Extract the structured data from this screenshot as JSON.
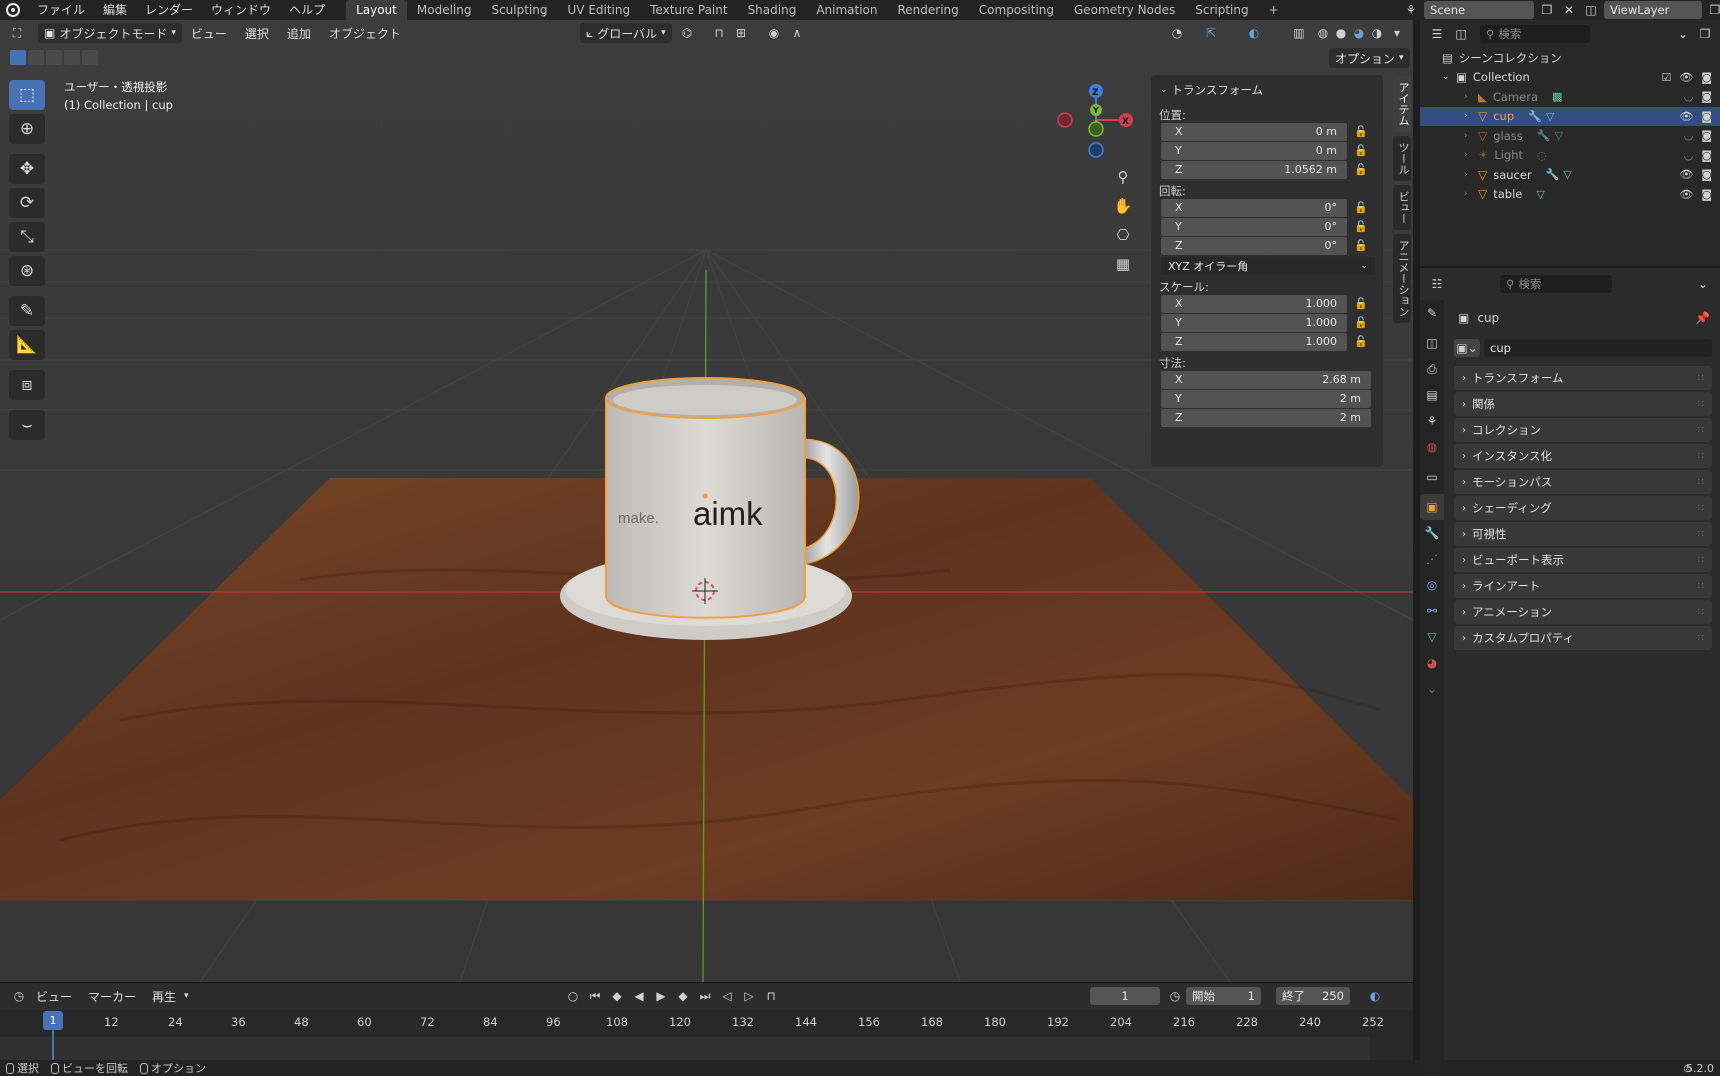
{
  "topbar": {
    "menus": [
      "ファイル",
      "編集",
      "レンダー",
      "ウィンドウ",
      "ヘルプ"
    ],
    "workspaces": [
      "Layout",
      "Modeling",
      "Sculpting",
      "UV Editing",
      "Texture Paint",
      "Shading",
      "Animation",
      "Rendering",
      "Compositing",
      "Geometry Nodes",
      "Scripting"
    ],
    "active_workspace": "Layout",
    "add_tab": "+",
    "scene": "Scene",
    "view_layer": "ViewLayer"
  },
  "viewport": {
    "mode": "オブジェクトモード",
    "menus": [
      "ビュー",
      "選択",
      "追加",
      "オブジェクト"
    ],
    "transform_orientation": "グローバル",
    "options_label": "オプション",
    "info_line1": "ユーザー・透視投影",
    "info_line2": "(1) Collection | cup",
    "gizmo": {
      "z": "Z",
      "y": "Y",
      "x": "X"
    },
    "mug_text_left": "make.",
    "mug_text_right": "aimk",
    "colors": {
      "axis_x": "#d0404f",
      "axis_y": "#7fb73b",
      "axis_z": "#3d7fd8",
      "selection": "#f0a040",
      "table": "#6b3a22"
    }
  },
  "npanel": {
    "title": "トランスフォーム",
    "location_label": "位置:",
    "location": [
      {
        "axis": "X",
        "value": "0 m"
      },
      {
        "axis": "Y",
        "value": "0 m"
      },
      {
        "axis": "Z",
        "value": "1.0562 m"
      }
    ],
    "rotation_label": "回転:",
    "rotation": [
      {
        "axis": "X",
        "value": "0°"
      },
      {
        "axis": "Y",
        "value": "0°"
      },
      {
        "axis": "Z",
        "value": "0°"
      }
    ],
    "rotation_mode": "XYZ オイラー角",
    "scale_label": "スケール:",
    "scale": [
      {
        "axis": "X",
        "value": "1.000"
      },
      {
        "axis": "Y",
        "value": "1.000"
      },
      {
        "axis": "Z",
        "value": "1.000"
      }
    ],
    "dimensions_label": "寸法:",
    "dimensions": [
      {
        "axis": "X",
        "value": "2.68 m"
      },
      {
        "axis": "Y",
        "value": "2 m"
      },
      {
        "axis": "Z",
        "value": "2 m"
      }
    ],
    "side_tabs": [
      "アイテム",
      "ツール",
      "ビュー",
      "アニメーション"
    ]
  },
  "timeline": {
    "menus": [
      "ビュー",
      "マーカー",
      "再生"
    ],
    "current_frame": "1",
    "start_label": "開始",
    "start": "1",
    "end_label": "終了",
    "end": "250",
    "ticks": [
      "1",
      "12",
      "24",
      "36",
      "48",
      "60",
      "72",
      "84",
      "96",
      "108",
      "120",
      "132",
      "144",
      "156",
      "168",
      "180",
      "192",
      "204",
      "216",
      "228",
      "240",
      "252"
    ]
  },
  "statusbar": {
    "items": [
      "選択",
      "ビューを回転",
      "オプション"
    ],
    "version": "5.2.0"
  },
  "outliner": {
    "search_placeholder": "検索",
    "scene_collection": "シーンコレクション",
    "collection": "Collection",
    "objects": [
      {
        "name": "Camera",
        "selected": false,
        "dim": true
      },
      {
        "name": "cup",
        "selected": true,
        "dim": false
      },
      {
        "name": "glass",
        "selected": false,
        "dim": true
      },
      {
        "name": "Light",
        "selected": false,
        "dim": true
      },
      {
        "name": "saucer",
        "selected": false,
        "dim": false
      },
      {
        "name": "table",
        "selected": false,
        "dim": false
      }
    ]
  },
  "properties": {
    "search_placeholder": "検索",
    "object_name": "cup",
    "object_field": "cup",
    "panels": [
      "トランスフォーム",
      "関係",
      "コレクション",
      "インスタンス化",
      "モーションパス",
      "シェーディング",
      "可視性",
      "ビューポート表示",
      "ラインアート",
      "アニメーション",
      "カスタムプロパティ"
    ]
  }
}
